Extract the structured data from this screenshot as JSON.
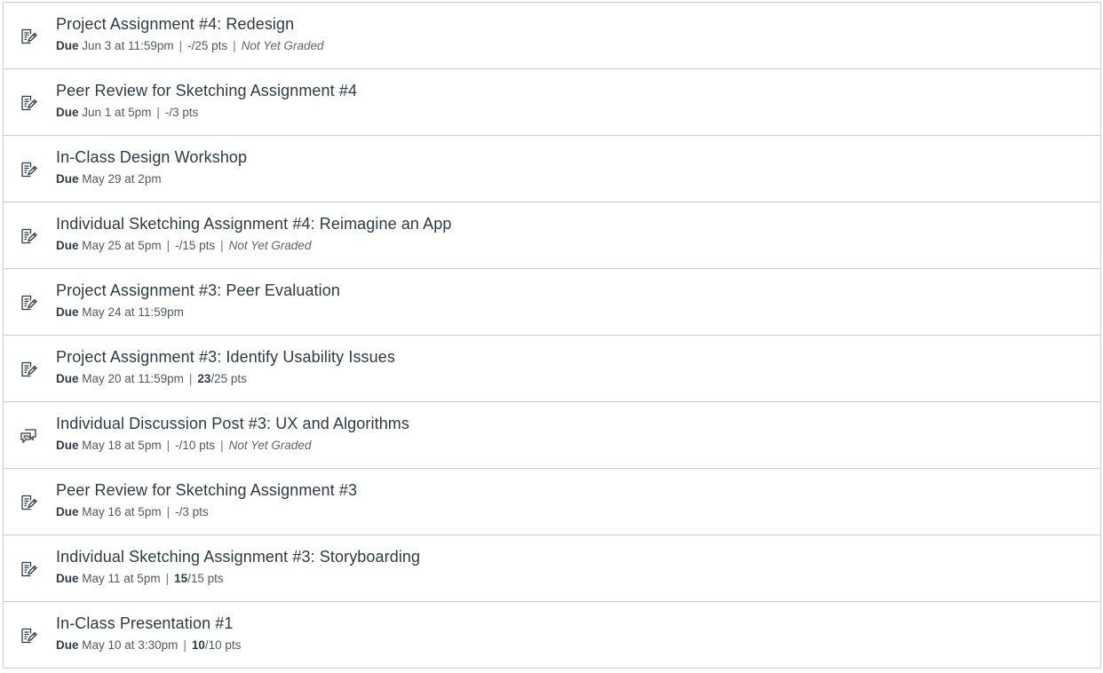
{
  "assignments": [
    {
      "type": "assignment",
      "icon": "assignment-icon",
      "title": "Project Assignment #4: Redesign",
      "due_label": "Due",
      "due_date": "Jun 3 at 11:59pm",
      "score": "-",
      "points": "/25 pts",
      "status": "Not Yet Graded"
    },
    {
      "type": "assignment",
      "icon": "assignment-icon",
      "title": "Peer Review for Sketching Assignment #4",
      "due_label": "Due",
      "due_date": "Jun 1 at 5pm",
      "score": "-",
      "points": "/3 pts",
      "status": ""
    },
    {
      "type": "assignment",
      "icon": "assignment-icon",
      "title": "In-Class Design Workshop",
      "due_label": "Due",
      "due_date": "May 29 at 2pm",
      "score": "",
      "points": "",
      "status": ""
    },
    {
      "type": "assignment",
      "icon": "assignment-icon",
      "title": "Individual Sketching Assignment #4: Reimagine an App",
      "due_label": "Due",
      "due_date": "May 25 at 5pm",
      "score": "-",
      "points": "/15 pts",
      "status": "Not Yet Graded"
    },
    {
      "type": "assignment",
      "icon": "assignment-icon",
      "title": "Project Assignment #3: Peer Evaluation",
      "due_label": "Due",
      "due_date": "May 24 at 11:59pm",
      "score": "",
      "points": "",
      "status": ""
    },
    {
      "type": "assignment",
      "icon": "assignment-icon",
      "title": "Project Assignment #3: Identify Usability Issues",
      "due_label": "Due",
      "due_date": "May 20 at 11:59pm",
      "score": "23",
      "points": "/25 pts",
      "status": ""
    },
    {
      "type": "discussion",
      "icon": "discussion-icon",
      "title": "Individual Discussion Post #3: UX and Algorithms",
      "due_label": "Due",
      "due_date": "May 18 at 5pm",
      "score": "-",
      "points": "/10 pts",
      "status": "Not Yet Graded"
    },
    {
      "type": "assignment",
      "icon": "assignment-icon",
      "title": "Peer Review for Sketching Assignment #3",
      "due_label": "Due",
      "due_date": "May 16 at 5pm",
      "score": "-",
      "points": "/3 pts",
      "status": ""
    },
    {
      "type": "assignment",
      "icon": "assignment-icon",
      "title": "Individual Sketching Assignment #3: Storyboarding",
      "due_label": "Due",
      "due_date": "May 11 at 5pm",
      "score": "15",
      "points": "/15 pts",
      "status": ""
    },
    {
      "type": "assignment",
      "icon": "assignment-icon",
      "title": "In-Class Presentation #1",
      "due_label": "Due",
      "due_date": "May 10 at 3:30pm",
      "score": "10",
      "points": "/10 pts",
      "status": ""
    }
  ]
}
